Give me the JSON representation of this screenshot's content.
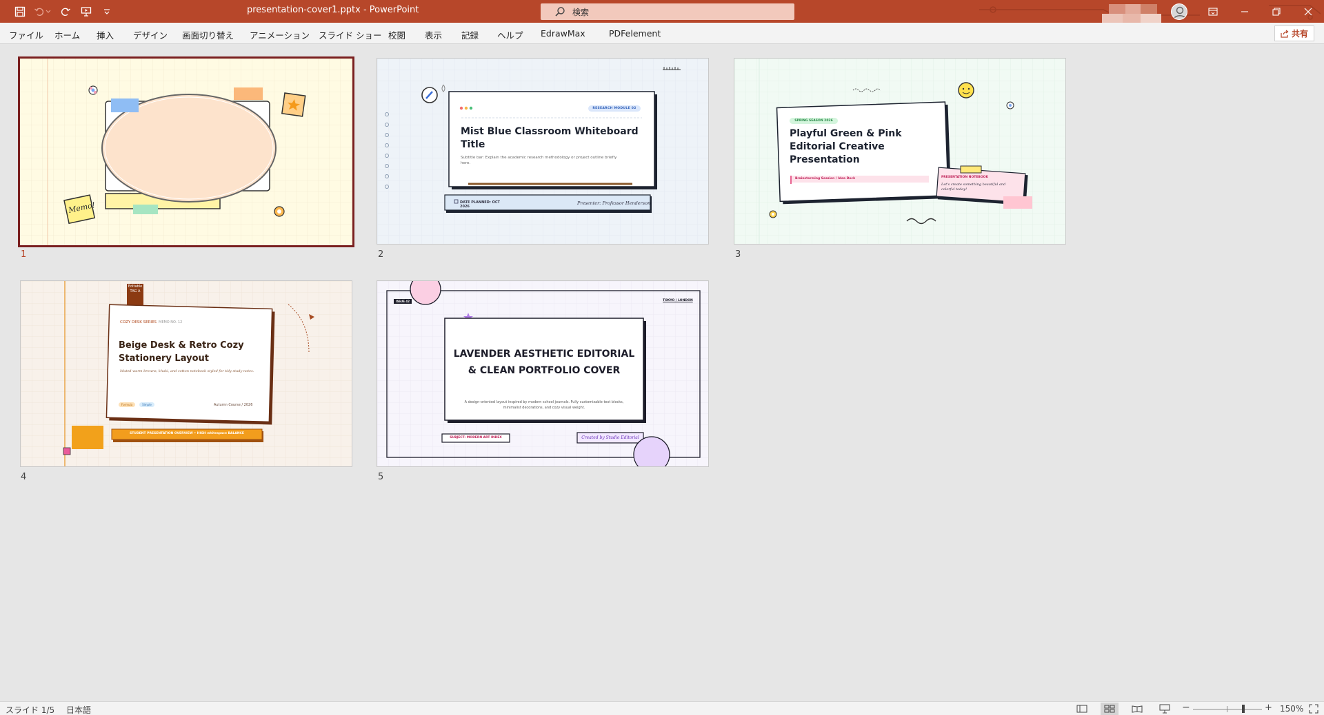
{
  "titlebar": {
    "doc_title": "presentation-cover1.pptx  -  PowerPoint",
    "search_placeholder": "検索"
  },
  "menu": {
    "items": [
      "ファイル",
      "ホーム",
      "挿入",
      "デザイン",
      "画面切り替え",
      "アニメーション",
      "スライド ショー",
      "校閲",
      "表示",
      "記録",
      "ヘルプ",
      "EdrawMax",
      "PDFelement"
    ],
    "share_label": "共有"
  },
  "slides": [
    {
      "number": "1",
      "sticky_note": "Memo!"
    },
    {
      "number": "2",
      "badge": "RESEARCH MODULE 02",
      "title": "Mist Blue Classroom Whiteboard Title",
      "subtitle": "Subtitle bar: Explain the academic research methodology or project outline briefly here.",
      "date": "DATE PLANNED: OCT 2026",
      "presenter": "Presenter: Professor Henderson"
    },
    {
      "number": "3",
      "badge": "SPRING SEASON 2026",
      "title": "Playful Green & Pink Editorial Creative Presentation",
      "tagline": "Brainstorming Session / Idea Deck",
      "note_title": "PRESENTATION NOTEBOOK",
      "note_body": "Let's create something beautiful and colorful today!"
    },
    {
      "number": "4",
      "tab": "Editable TAG A",
      "series": "COZY DESK SERIES",
      "memo": "MEMO NO. 12",
      "title": "Beige Desk & Retro Cozy Stationery Layout",
      "subtitle": "Muted warm browns, khaki, and cotton notebook styled for tidy study notes.",
      "tag1": "Formula",
      "tag2": "Simple",
      "course": "Autumn Course / 2026",
      "banner": "STUDENT PRESENTATION OVERVIEW • HIGH whitespace BALANCE"
    },
    {
      "number": "5",
      "issue": "ISSUE 42",
      "city": "TOKYO / LONDON",
      "title": "LAVENDER AESTHETIC EDITORIAL & CLEAN PORTFOLIO COVER",
      "subtitle": "A design-oriented layout inspired by modern school journals. Fully customizable text blocks, minimalist decorations, and cozy visual weight.",
      "subject": "SUBJECT: MODERN ART INDEX",
      "credit": "Created by Studio Editorial"
    }
  ],
  "statusbar": {
    "slide_indicator": "スライド 1/5",
    "language": "日本語",
    "zoom_minus": "−",
    "zoom_plus": "+",
    "zoom": "150%"
  },
  "colors": {
    "accent": "#b7472a",
    "selected_border": "#7a1f1f"
  }
}
